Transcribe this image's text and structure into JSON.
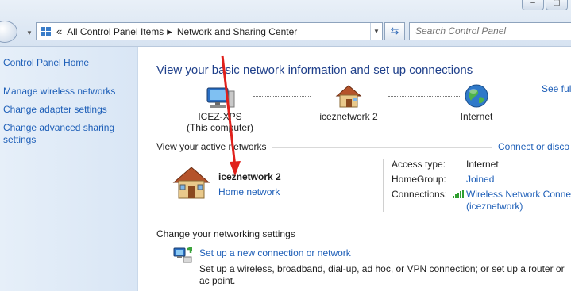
{
  "addressbar": {
    "chevron": "«",
    "crumbs": [
      "All Control Panel Items",
      "Network and Sharing Center"
    ],
    "separator": "▸"
  },
  "search": {
    "placeholder": "Search Control Panel"
  },
  "window_controls": [
    "–",
    "▢"
  ],
  "sidebar": {
    "home": "Control Panel Home",
    "items": [
      "Manage wireless networks",
      "Change adapter settings",
      "Change advanced sharing",
      "settings"
    ]
  },
  "main": {
    "title": "View your basic network information and set up connections",
    "see_full_map": "See full",
    "nodes": {
      "computer": {
        "name": "ICEZ-XPS",
        "sub": "(This computer)"
      },
      "network": {
        "name": "iceznetwork  2"
      },
      "internet": {
        "name": "Internet"
      }
    },
    "active_header": "View your active networks",
    "connect_disconnect": "Connect or disco",
    "active_network": {
      "name": "iceznetwork  2",
      "type": "Home network"
    },
    "details": {
      "access_type_label": "Access type:",
      "access_type_value": "Internet",
      "homegroup_label": "HomeGroup:",
      "homegroup_value": "Joined",
      "connections_label": "Connections:",
      "connections_value_1": "Wireless Network Conne",
      "connections_value_2": "(iceznetwork)"
    },
    "change_header": "Change your networking settings",
    "setup": {
      "link": "Set up a new connection or network",
      "desc": "Set up a wireless, broadband, dial-up, ad hoc, or VPN connection; or set up a router or ac point."
    }
  },
  "colors": {
    "link": "#1e5fb8",
    "title": "#1e3f8a",
    "annotation_arrow": "#e0201b"
  },
  "icons": [
    "control-panel-icon",
    "refresh-icon",
    "computer-icon",
    "house-icon",
    "globe-icon",
    "signal-bars-icon",
    "network-setup-icon"
  ]
}
